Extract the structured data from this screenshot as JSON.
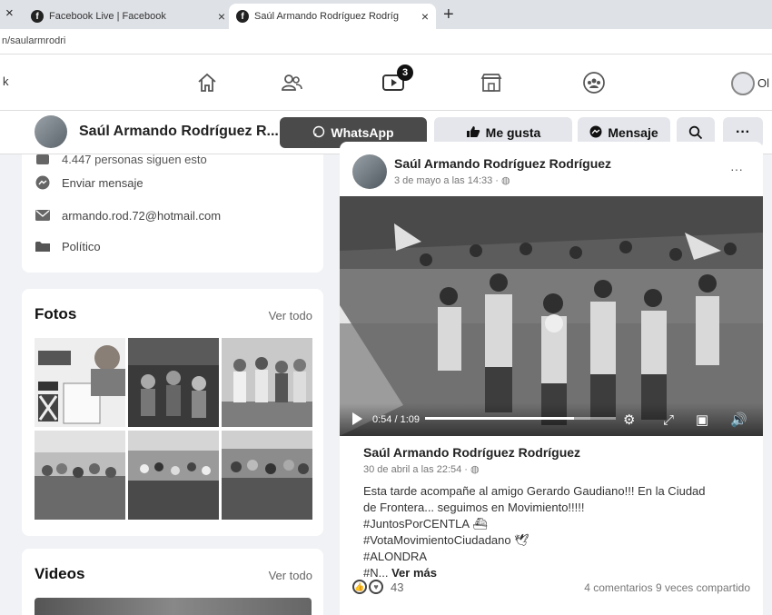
{
  "browser": {
    "tabs": [
      {
        "title": "Facebook Live | Facebook"
      },
      {
        "title": "Saúl Armando Rodríguez Rodríg"
      }
    ],
    "url": "n/saularmrodri"
  },
  "nav": {
    "edge_text": "k",
    "watch_badge": "3",
    "profile_text": "Ol"
  },
  "profile": {
    "name": "Saúl Armando Rodríguez R...",
    "actions": {
      "whatsapp": "WhatsApp",
      "like": "Me gusta",
      "message": "Mensaje"
    }
  },
  "intro": {
    "followers": "4.447 personas siguen esto",
    "send_message": "Enviar mensaje",
    "email": "armando.rod.72@hotmail.com",
    "category": "Político"
  },
  "photos": {
    "title": "Fotos",
    "see_all": "Ver todo"
  },
  "videos": {
    "title": "Videos",
    "see_all": "Ver todo"
  },
  "post": {
    "author": "Saúl Armando Rodríguez Rodríguez",
    "time": "3 de mayo a las 14:33 · ",
    "video": {
      "time": "0:54 / 1:09",
      "progress": 0.78
    },
    "shared_author": "Saúl Armando Rodríguez Rodríguez",
    "shared_time": "30 de abril a las 22:54 · ",
    "text_lines": [
      "Esta tarde acompañe al amigo Gerardo Gaudiano!!! En la Ciudad",
      "de Frontera... seguimos en Movimiento!!!!!",
      "#JuntosPorCENTLA",
      "#VotaMovimientoCiudadano",
      "#ALONDRA",
      "#N..."
    ],
    "see_more": "Ver más",
    "reactions_count": "43",
    "comments": "4 comentarios",
    "shares": "9 veces compartido"
  }
}
